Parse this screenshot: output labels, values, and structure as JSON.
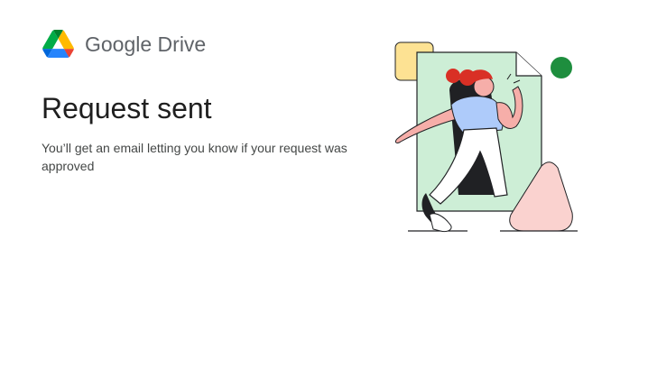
{
  "brand": {
    "product_name": "Google Drive",
    "logo_icon": "google-drive-logo-icon",
    "logo_colors": [
      "#0066da",
      "#00ac47",
      "#ea4335",
      "#00832d",
      "#2684fc",
      "#ffba00"
    ]
  },
  "main": {
    "title": "Request sent",
    "message": "You’ll get an email letting you know if your request was approved"
  },
  "illustration": {
    "icon": "person-walking-through-document-illustration",
    "colors": {
      "document": "#cdeed6",
      "sticky_note": "#fde293",
      "dot": "#1e8e3e",
      "triangle": "#fad2cf",
      "hair": "#d93025",
      "shirt": "#aecbfa",
      "skin": "#f6aea9",
      "outline": "#202124"
    }
  }
}
